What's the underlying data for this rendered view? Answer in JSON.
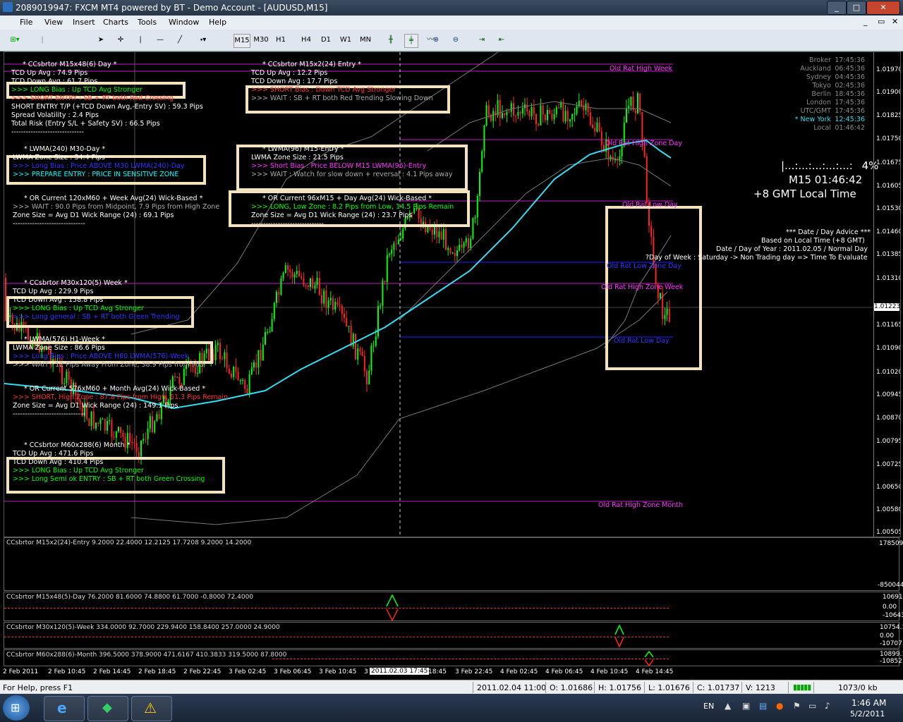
{
  "window": {
    "title": "2089019947: FXCM MT4 powered by BT - Demo Account - [AUDUSD,M15]",
    "btn_min": "_",
    "btn_max": "□",
    "btn_close": "✕"
  },
  "menu": [
    "File",
    "View",
    "Insert",
    "Charts",
    "Tools",
    "Window",
    "Help"
  ],
  "timeframes": [
    "M15",
    "M30",
    "H1",
    "H4",
    "D1",
    "W1",
    "MN"
  ],
  "blocks": [
    {
      "title": "* CCsbrtor M15x48(6) Day *",
      "lines": [
        {
          "t": "TCD Up Avg : 74.9 Pips",
          "c": "#ffffff"
        },
        {
          "t": "TCD Down Avg : 61.7 Pips",
          "c": "#ffffff"
        },
        {
          "t": ">>> LONG Bias : Up TCD Avg Stronger",
          "c": "#00ff00"
        },
        {
          "t": ">>> SHORT ENTRY : SB + RT both Red Crossing",
          "c": "#ff3333"
        },
        {
          "t": "SHORT ENTRY T/P (+TCD Down Avg,-Entry SV) : 59.3 Pips",
          "c": "#ffffff"
        },
        {
          "t": "Spread Volatility : 2.4 Pips",
          "c": "#ffffff"
        },
        {
          "t": "Total Risk (Entry S/L + Safety SV) : 66.5 Pips",
          "c": "#ffffff"
        },
        {
          "t": "------------------------------",
          "c": "#ffffff"
        }
      ]
    },
    {
      "title": "* LWMA(240) M30-Day *",
      "lines": [
        {
          "t": "LWMA Zone Size : 34.4 Pips",
          "c": "#ffffff"
        },
        {
          "t": ">>> Long Bias : Price ABOVE M30 LWMA(240)-Day",
          "c": "#3333ff"
        },
        {
          "t": ">>> PREPARE ENTRY : PRICE IN SENSITIVE ZONE",
          "c": "#00ffff"
        }
      ]
    },
    {
      "title": "* OR Current 120xM60 + Week Avg(24) Wick-Based *",
      "lines": [
        {
          "t": ">>> WAIT : 90.0 Pips from Midpoint, 7.9 Pips from High Zone",
          "c": "#aaaaaa"
        },
        {
          "t": "Zone Size = Avg D1 Wick Range (24) : 69.1 Pips",
          "c": "#ffffff"
        },
        {
          "t": "------------------------------",
          "c": "#ffffff"
        }
      ]
    },
    {
      "title": "* CCsbrtor M30x120(5) Week *",
      "lines": [
        {
          "t": "TCD Up Avg : 229.9 Pips",
          "c": "#ffffff"
        },
        {
          "t": "TCD Down Avg : 158.8 Pips",
          "c": "#ffffff"
        },
        {
          "t": ">>> LONG Bias : Up TCD Avg Stronger",
          "c": "#00ff00"
        },
        {
          "t": ">>> Long general : SB + RT both Green Trending",
          "c": "#3333ff"
        }
      ]
    },
    {
      "title": "* LWMA(576) H1-Week *",
      "lines": [
        {
          "t": "LWMA Zone Size : 86.6 Pips",
          "c": "#ffffff"
        },
        {
          "t": ">>> Long Bias : Price ABOVE H60 LWMA(576)-Week",
          "c": "#3333ff"
        },
        {
          "t": ">>> WAIT : 12 Pips Away From Zone, 38.9 Pips from Mid",
          "c": "#aaaaaa"
        }
      ]
    },
    {
      "title": "* OR Current 576xM60 + Month Avg(24) Wick-Based *",
      "lines": [
        {
          "t": ">>> SHORT, High Zone : 87.8 Pips from High, 61.3 Pips Remain",
          "c": "#ff3333"
        },
        {
          "t": "Zone Size = Avg D1 Wick Range (24) : 149.1 Pips",
          "c": "#ffffff"
        },
        {
          "t": "------------------------------",
          "c": "#ffffff"
        }
      ]
    },
    {
      "title": "* CCsbrtor M60x288(6) Month *",
      "lines": [
        {
          "t": "TCD Up Avg : 471.6 Pips",
          "c": "#ffffff"
        },
        {
          "t": "TCD Down Avg : 410.4 Pips",
          "c": "#ffffff"
        },
        {
          "t": ">>> LONG Bias : Up TCD Avg Stronger",
          "c": "#00ff00"
        },
        {
          "t": ">>> Long Semi ok ENTRY : SB + RT both Green Crossing",
          "c": "#00ff00"
        }
      ]
    },
    {
      "title": "* CCsbrtor M15x2(24) Entry *",
      "lines": [
        {
          "t": "TCD Up Avg : 12.2 Pips",
          "c": "#ffffff"
        },
        {
          "t": "TCD Down Avg : 17.7 Pips",
          "c": "#ffffff"
        },
        {
          "t": ">>> SHORT Bias : Down TCD Avg Stronger",
          "c": "#ff3333"
        },
        {
          "t": ">>> WAIT : SB + RT both Red Trending Slowing Down",
          "c": "#aaaaaa"
        }
      ]
    },
    {
      "title": "* LWMA(96) M15-Entry *",
      "lines": [
        {
          "t": "LWMA Zone Size : 21.5 Pips",
          "c": "#ffffff"
        },
        {
          "t": ">>> Short Bias : Price BELOW M15 LWMA(96)-Entry",
          "c": "#ff33ff"
        },
        {
          "t": ">>> WAIT : Watch for slow down + reversal : 4.1 Pips away",
          "c": "#aaaaaa"
        }
      ]
    },
    {
      "title": "* OR Current 96xM15 + Day Avg(24) Wick-Based *",
      "lines": [
        {
          "t": ">>> LONG, Low Zone : 8.2 Pips from Low, 14.5 Pips Remain",
          "c": "#00ff00"
        },
        {
          "t": "Zone Size = Avg D1 Wick Range (24) : 23.7 Pips",
          "c": "#ffffff"
        },
        {
          "t": "------------------------------",
          "c": "#ffffff"
        }
      ]
    }
  ],
  "clocks": [
    {
      "city": "Broker",
      "time": "17:45:36"
    },
    {
      "city": "Auckland",
      "time": "06:45:36"
    },
    {
      "city": "Sydney",
      "time": "04:45:36"
    },
    {
      "city": "Tokyo",
      "time": "02:45:36"
    },
    {
      "city": "Berlin",
      "time": "18:45:36"
    },
    {
      "city": "London",
      "time": "17:45:36"
    },
    {
      "city": "UTC/GMT",
      "time": "17:45:36"
    },
    {
      "city": "* New York",
      "time": "12:45:36"
    },
    {
      "city": "Local",
      "time": "01:46:42"
    }
  ],
  "progress": {
    "dots": "|...:...:...:...:...:",
    "pct": "4%"
  },
  "m15_clock": "M15 01:46:42",
  "gmt_label": "+8 GMT Local Time",
  "advice": [
    "*** Date / Day Advice ***",
    "Based on Local Time (+8 GMT)",
    "Date / Day of Year : 2011.02.05 / Normal Day",
    "?Day of Week : Saturday -> Non Trading day => Time To Evaluate"
  ],
  "zone_labels": [
    {
      "t": "Old Rat High Week",
      "c": "#ff33ff"
    },
    {
      "t": "Old Rat High Zone Day",
      "c": "#ff33ff"
    },
    {
      "t": "Old Rat Low Day",
      "c": "#ff33ff"
    },
    {
      "t": "Old Rat Low Zone Day",
      "c": "#3333ff"
    },
    {
      "t": "Old Rat High Zone Week",
      "c": "#ff33ff"
    },
    {
      "t": "Old Rat Low Day",
      "c": "#3333ff"
    },
    {
      "t": "Old Rat High Zone Month",
      "c": "#ff33ff"
    }
  ],
  "price_axis": [
    "1.01970",
    "1.01900",
    "1.01825",
    "1.01750",
    "1.01675",
    "1.01605",
    "1.01530",
    "1.01460",
    "1.01385",
    "1.01310",
    "1.01223",
    "1.01165",
    "1.01090",
    "1.01020",
    "1.00945",
    "1.00870",
    "1.00795",
    "1.00725",
    "1.00650",
    "1.00580",
    "1.00505"
  ],
  "current_price": "1.01223",
  "subwindows": [
    {
      "title": "CCsbrtor M15x2(24)-Entry 9.2000 22.4000 12.2125 17.7208 9.2000 14.2000",
      "axis": [
        "1785095",
        "-8500445"
      ]
    },
    {
      "title": "CCsbrtor M15x48(5)-Day 76.2000 81.6000 74.8800 61.7000 -0.8000 72.4000",
      "axis": [
        "10691.91",
        "0.00",
        "-10643.9"
      ]
    },
    {
      "title": "CCsbrtor M30x120(5)-Week 334.0000 92.7000 229.9400 158.8400 257.0000 24.9000",
      "axis": [
        "10754.1",
        "0.00",
        "-10707.4"
      ]
    },
    {
      "title": "CCsbrtor M60x288(6)-Month 396.5000 378.9000 471.6167 410.3833 319.5000 87.8000",
      "axis": [
        "10899.1",
        "-10852.5"
      ]
    }
  ],
  "time_axis": [
    "2 Feb 2011",
    "2 Feb 10:45",
    "2 Feb 14:45",
    "2 Feb 18:45",
    "2 Feb 22:45",
    "3 Feb 02:45",
    "3 Feb 06:45",
    "3 Feb 10:45",
    "3",
    "2011.02.03 17:45",
    "18:45",
    "3 Feb 22:45",
    "4 Feb 02:45",
    "4 Feb 06:45",
    "4 Feb 10:45",
    "4 Feb 14:45"
  ],
  "status": {
    "help": "For Help, press F1",
    "date": "2011.02.04 11:00",
    "open": "O: 1.01686",
    "high": "H: 1.01756",
    "low": "L: 1.01676",
    "close": "C: 1.01737",
    "vol": "V: 1213",
    "kb": "1073/0 kb"
  },
  "tray": {
    "lang": "EN",
    "time": "1:46 AM",
    "date": "5/2/2011"
  },
  "colors": {
    "lwma": "#33ddee",
    "bull": "#00ff00",
    "bear": "#ff2222",
    "envelope": "#777777",
    "magenta": "#c020c0",
    "blue": "#2020ff",
    "box": "#f3e4bd"
  }
}
